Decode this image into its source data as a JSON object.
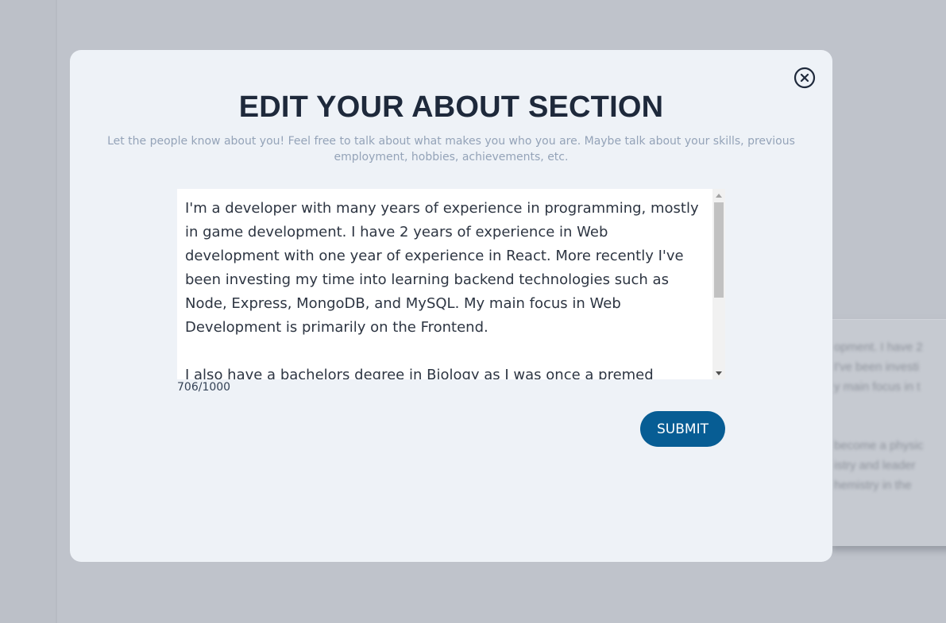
{
  "background": {
    "card_lines_1": [
      "opment. I have 2",
      "I've been investi",
      "y main focus in t"
    ],
    "card_lines_2": [
      "become a physic",
      "istry and leader",
      "hemistry in the"
    ]
  },
  "modal": {
    "title": "EDIT YOUR ABOUT SECTION",
    "subtitle": "Let the people know about you! Feel free to talk about what makes you who you are. Maybe talk about your skills, previous employment, hobbies, achievements, etc.",
    "textarea_value": "I'm a developer with many years of experience in programming, mostly in game development. I have 2 years of experience in Web development with one year of experience in React. More recently I've been investing my time into learning backend technologies such as Node, Express, MongoDB, and MySQL. My main focus in Web Development is primarily on the Frontend.\n\nI also have a bachelors degree in Biology as I was once a premed",
    "char_count": "706/1000",
    "submit_label": "SUBMIT",
    "close_icon": "close-circle-icon"
  },
  "colors": {
    "overlay": "#bfc3cb",
    "modal_bg": "#eef2f7",
    "title": "#1e293b",
    "subtitle": "#94a3b8",
    "submit_bg": "#075d94",
    "submit_text": "#ffffff"
  }
}
